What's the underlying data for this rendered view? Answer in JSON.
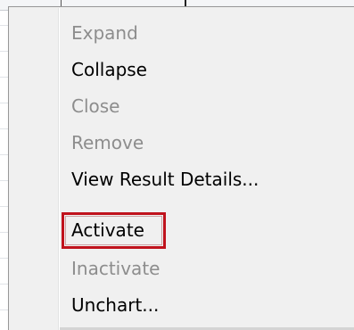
{
  "context_menu": {
    "items": [
      {
        "label": "Expand",
        "enabled": false
      },
      {
        "label": "Collapse",
        "enabled": true
      },
      {
        "label": "Close",
        "enabled": false
      },
      {
        "label": "Remove",
        "enabled": false
      },
      {
        "label": "View Result Details...",
        "enabled": true
      },
      {
        "label": "Activate",
        "enabled": true,
        "highlighted": true
      },
      {
        "label": "Inactivate",
        "enabled": false
      },
      {
        "label": "Unchart...",
        "enabled": true
      }
    ]
  },
  "colors": {
    "highlight": "#c0121c",
    "disabled_text": "#8d8d8d",
    "menu_background": "#f0f0f0"
  }
}
